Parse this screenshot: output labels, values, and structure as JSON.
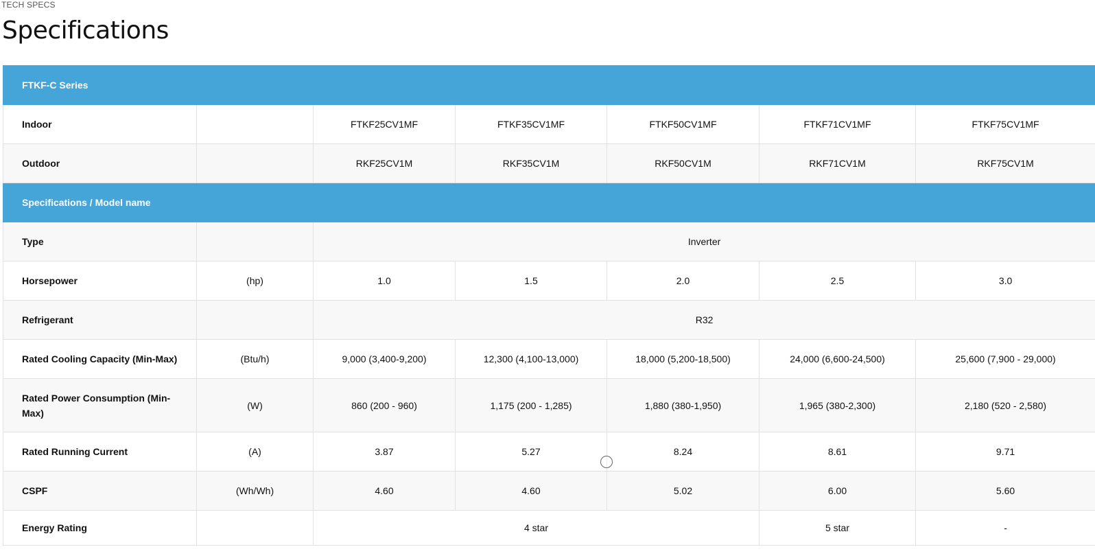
{
  "header": {
    "eyebrow": "TECH SPECS",
    "title": "Specifications"
  },
  "colors": {
    "section_bg": "#45a5d9",
    "alt_row_bg": "#f8f8f8",
    "border": "#e2e2e2"
  },
  "sections": {
    "series": "FTKF-C Series",
    "specs": "Specifications / Model name"
  },
  "models": {
    "indoor_label": "Indoor",
    "indoor": [
      "FTKF25CV1MF",
      "FTKF35CV1MF",
      "FTKF50CV1MF",
      "FTKF71CV1MF",
      "FTKF75CV1MF"
    ],
    "outdoor_label": "Outdoor",
    "outdoor": [
      "RKF25CV1M",
      "RKF35CV1M",
      "RKF50CV1M",
      "RKF71CV1M",
      "RKF75CV1M"
    ]
  },
  "rows": {
    "type": {
      "label": "Type",
      "unit": "",
      "value": "Inverter"
    },
    "horsepower": {
      "label": "Horsepower",
      "unit": "(hp)",
      "values": [
        "1.0",
        "1.5",
        "2.0",
        "2.5",
        "3.0"
      ]
    },
    "refrigerant": {
      "label": "Refrigerant",
      "unit": "",
      "value": "R32"
    },
    "cooling": {
      "label": "Rated Cooling Capacity (Min-Max)",
      "unit": "(Btu/h)",
      "values": [
        "9,000 (3,400-9,200)",
        "12,300 (4,100-13,000)",
        "18,000 (5,200-18,500)",
        "24,000 (6,600-24,500)",
        "25,600 (7,900 - 29,000)"
      ]
    },
    "power": {
      "label": "Rated Power Consumption (Min-Max)",
      "unit": "(W)",
      "values": [
        "860 (200 - 960)",
        "1,175 (200 - 1,285)",
        "1,880 (380-1,950)",
        "1,965 (380-2,300)",
        "2,180 (520 - 2,580)"
      ]
    },
    "current": {
      "label": "Rated Running Current",
      "unit": "(A)",
      "values": [
        "3.87",
        "5.27",
        "8.24",
        "8.61",
        "9.71"
      ]
    },
    "cspf": {
      "label": "CSPF",
      "unit": "(Wh/Wh)",
      "values": [
        "4.60",
        "4.60",
        "5.02",
        "6.00",
        "5.60"
      ]
    },
    "energy": {
      "label": "Energy Rating",
      "unit": "",
      "values": [
        "4 star",
        "5 star",
        "-"
      ]
    }
  }
}
